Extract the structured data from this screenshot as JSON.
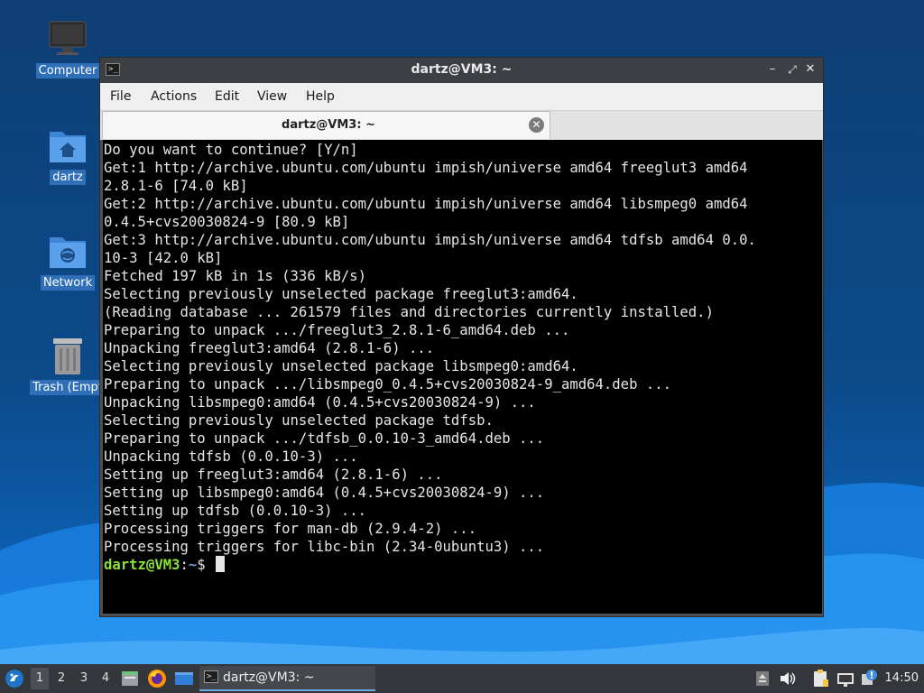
{
  "desktop": {
    "icons": [
      {
        "label": "Computer"
      },
      {
        "label": "dartz"
      },
      {
        "label": "Network"
      },
      {
        "label": "Trash (Empt"
      }
    ]
  },
  "window": {
    "title": "dartz@VM3: ~",
    "menu": {
      "file": "File",
      "actions": "Actions",
      "edit": "Edit",
      "view": "View",
      "help": "Help"
    },
    "tab_label": "dartz@VM3: ~",
    "terminal_lines": [
      "Do you want to continue? [Y/n]",
      "Get:1 http://archive.ubuntu.com/ubuntu impish/universe amd64 freeglut3 amd64",
      "2.8.1-6 [74.0 kB]",
      "Get:2 http://archive.ubuntu.com/ubuntu impish/universe amd64 libsmpeg0 amd64",
      "0.4.5+cvs20030824-9 [80.9 kB]",
      "Get:3 http://archive.ubuntu.com/ubuntu impish/universe amd64 tdfsb amd64 0.0.",
      "10-3 [42.0 kB]",
      "Fetched 197 kB in 1s (336 kB/s)",
      "Selecting previously unselected package freeglut3:amd64.",
      "(Reading database ... 261579 files and directories currently installed.)",
      "Preparing to unpack .../freeglut3_2.8.1-6_amd64.deb ...",
      "Unpacking freeglut3:amd64 (2.8.1-6) ...",
      "Selecting previously unselected package libsmpeg0:amd64.",
      "Preparing to unpack .../libsmpeg0_0.4.5+cvs20030824-9_amd64.deb ...",
      "Unpacking libsmpeg0:amd64 (0.4.5+cvs20030824-9) ...",
      "Selecting previously unselected package tdfsb.",
      "Preparing to unpack .../tdfsb_0.0.10-3_amd64.deb ...",
      "Unpacking tdfsb (0.0.10-3) ...",
      "Setting up freeglut3:amd64 (2.8.1-6) ...",
      "Setting up libsmpeg0:amd64 (0.4.5+cvs20030824-9) ...",
      "Setting up tdfsb (0.0.10-3) ...",
      "Processing triggers for man-db (2.9.4-2) ...",
      "Processing triggers for libc-bin (2.34-0ubuntu3) ..."
    ],
    "prompt": {
      "user_host": "dartz@VM3",
      "colon": ":",
      "path": "~",
      "symbol": "$ "
    }
  },
  "taskbar": {
    "workspaces": [
      "1",
      "2",
      "3",
      "4"
    ],
    "task_label": "dartz@VM3: ~",
    "clock": "14:50"
  },
  "colors": {
    "prompt_user": "#8ae234",
    "prompt_path": "#729fcf",
    "terminal_bg": "#000000",
    "taskbar_bg": "#33363a"
  }
}
